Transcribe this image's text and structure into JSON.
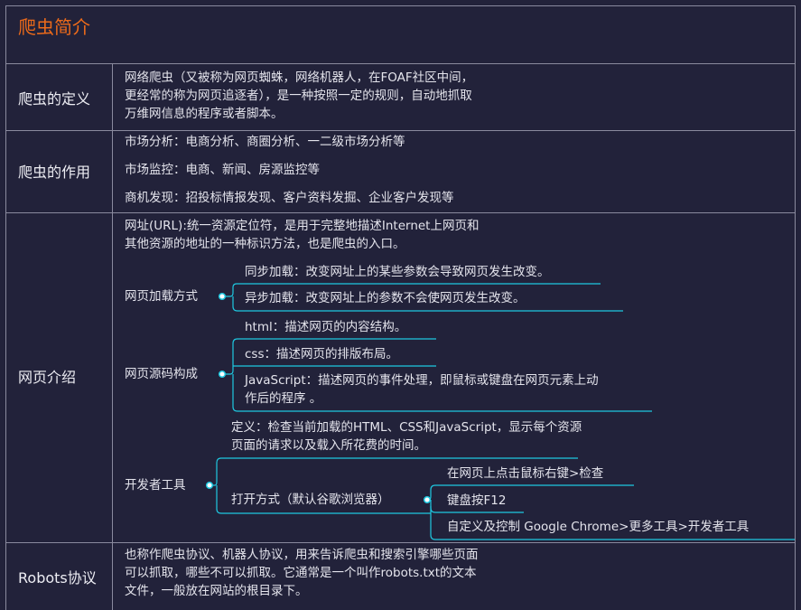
{
  "title": "爬虫简介",
  "rows": {
    "definition": {
      "label": "爬虫的定义",
      "lines": [
        "网络爬虫（又被称为网页蜘蛛，网络机器人，在FOAF社区中间，",
        "更经常的称为网页追逐者），是一种按照一定的规则，自动地抓取",
        "万维网信息的程序或者脚本。"
      ]
    },
    "usage": {
      "label": "爬虫的作用",
      "items": [
        "市场分析：电商分析、商圈分析、一二级市场分析等",
        "市场监控：电商、新闻、房源监控等",
        "商机发现：招投标情报发现、客户资料发掘、企业客户发现等"
      ]
    },
    "webpage": {
      "label": "网页介绍",
      "url_lines": [
        "网址(URL):统一资源定位符，是用于完整地描述Internet上网页和",
        "其他资源的地址的一种标识方法，也是爬虫的入口。"
      ],
      "loading": {
        "label": "网页加载方式",
        "items": [
          "同步加载：改变网址上的某些参数会导致网页发生改变。",
          "异步加载：改变网址上的参数不会使网页发生改变。"
        ]
      },
      "source": {
        "label": "网页源码构成",
        "html": "html：描述网页的内容结构。",
        "css": "css：描述网页的排版布局。",
        "js_lines": [
          "JavaScript：描述网页的事件处理，即鼠标或键盘在网页元素上动",
          "作后的程序 。"
        ]
      },
      "devtools": {
        "label": "开发者工具",
        "definition_lines": [
          "定义：检查当前加载的HTML、CSS和JavaScript，显示每个资源",
          "页面的请求以及载入所花费的时间。"
        ],
        "open_label": "打开方式（默认谷歌浏览器）",
        "open_items": [
          "在网页上点击鼠标右键>检查",
          "键盘按F12",
          "自定义及控制 Google Chrome>更多工具>开发者工具"
        ]
      }
    },
    "robots": {
      "label": "Robots协议",
      "lines": [
        "也称作爬虫协议、机器人协议，用来告诉爬虫和搜索引擎哪些页面",
        "可以抓取，哪些不可以抓取。它通常是一个叫作robots.txt的文本",
        "文件，一般放在网站的根目录下。"
      ]
    }
  },
  "colors": {
    "background": "#22223a",
    "title": "#ec6a1a",
    "text": "#e4e4ec",
    "grid": "#8a8a9e",
    "connector": "#1ec8e0"
  }
}
